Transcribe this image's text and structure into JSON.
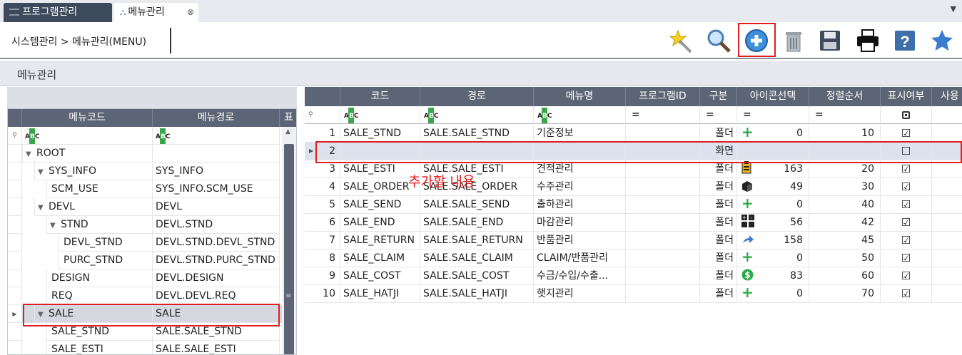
{
  "tabs": [
    {
      "label": "프로그램관리"
    },
    {
      "label": "메뉴관리"
    }
  ],
  "breadcrumb": "시스템관리 > 메뉴관리(MENU)",
  "toolbar": {
    "buttons": [
      "new-icon",
      "search-icon",
      "add-icon",
      "delete-icon",
      "save-icon",
      "print-icon",
      "help-icon",
      "favorite-icon"
    ],
    "highlighted": "add-icon"
  },
  "panel_title": "메뉴관리",
  "left_grid": {
    "columns": [
      "메뉴코드",
      "메뉴경로",
      "표"
    ],
    "rows": [
      {
        "level": 0,
        "expand": "▼",
        "code": "ROOT",
        "path": ""
      },
      {
        "level": 1,
        "expand": "▼",
        "code": "SYS_INFO",
        "path": "SYS_INFO"
      },
      {
        "level": 2,
        "expand": "",
        "code": "SCM_USE",
        "path": "SYS_INFO.SCM_USE"
      },
      {
        "level": 1,
        "expand": "▼",
        "code": "DEVL",
        "path": "DEVL"
      },
      {
        "level": 2,
        "expand": "▼",
        "code": "STND",
        "path": "DEVL.STND"
      },
      {
        "level": 3,
        "expand": "",
        "code": "DEVL_STND",
        "path": "DEVL.STND.DEVL_STND"
      },
      {
        "level": 3,
        "expand": "",
        "code": "PURC_STND",
        "path": "DEVL.STND.PURC_STND"
      },
      {
        "level": 2,
        "expand": "",
        "code": "DESIGN",
        "path": "DEVL.DESIGN"
      },
      {
        "level": 2,
        "expand": "",
        "code": "REQ",
        "path": "DEVL.DEVL.REQ"
      },
      {
        "level": 1,
        "expand": "▼",
        "code": "SALE",
        "path": "SALE"
      },
      {
        "level": 2,
        "expand": "",
        "code": "SALE_STND",
        "path": "SALE.SALE_STND"
      },
      {
        "level": 2,
        "expand": "",
        "code": "SALE_ESTI",
        "path": "SALE.SALE_ESTI"
      }
    ]
  },
  "right_grid": {
    "columns": [
      "코드",
      "경로",
      "메뉴명",
      "프로그램ID",
      "구분",
      "아이콘선택",
      "정렬순서",
      "표시여부",
      "사용"
    ],
    "rows": [
      {
        "no": "1",
        "code": "SALE_STND",
        "path": "SALE.SALE_STND",
        "name": "기준정보",
        "type": "폴더",
        "icon": "plus",
        "icon_no": "0",
        "order": "10",
        "show": "☑"
      },
      {
        "no": "2",
        "code": "",
        "path": "",
        "name": "",
        "type": "화면",
        "icon": "",
        "icon_no": "",
        "order": "",
        "show": "☐"
      },
      {
        "no": "3",
        "code": "SALE_ESTI",
        "path": "SALE.SALE_ESTI",
        "name": "견적관리",
        "type": "폴더",
        "icon": "clipboard",
        "icon_no": "163",
        "order": "20",
        "show": "☑"
      },
      {
        "no": "4",
        "code": "SALE_ORDER",
        "path": "SALE.SALE_ORDER",
        "name": "수주관리",
        "type": "폴더",
        "icon": "box",
        "icon_no": "49",
        "order": "30",
        "show": "☑"
      },
      {
        "no": "5",
        "code": "SALE_SEND",
        "path": "SALE.SALE_SEND",
        "name": "출하관리",
        "type": "폴더",
        "icon": "plus",
        "icon_no": "0",
        "order": "40",
        "show": "☑"
      },
      {
        "no": "6",
        "code": "SALE_END",
        "path": "SALE.SALE_END",
        "name": "마감관리",
        "type": "폴더",
        "icon": "calc",
        "icon_no": "56",
        "order": "42",
        "show": "☑"
      },
      {
        "no": "7",
        "code": "SALE_RETURN",
        "path": "SALE.SALE_RETURN",
        "name": "반품관리",
        "type": "폴더",
        "icon": "arrow",
        "icon_no": "158",
        "order": "45",
        "show": "☑"
      },
      {
        "no": "8",
        "code": "SALE_CLAIM",
        "path": "SALE.SALE_CLAIM",
        "name": "CLAIM/반품관리",
        "type": "폴더",
        "icon": "plus",
        "icon_no": "0",
        "order": "50",
        "show": "☑"
      },
      {
        "no": "9",
        "code": "SALE_COST",
        "path": "SALE.SALE_COST",
        "name": "수금/수입/수출...",
        "type": "폴더",
        "icon": "dollar",
        "icon_no": "83",
        "order": "60",
        "show": "☑"
      },
      {
        "no": "10",
        "code": "SALE_HATJI",
        "path": "SALE.SALE_HATJI",
        "name": "햇지관리",
        "type": "폴더",
        "icon": "plus",
        "icon_no": "0",
        "order": "70",
        "show": "☑"
      }
    ]
  },
  "annotation": "추가할 내용",
  "colors": {
    "accent": "#e02020",
    "header": "#5c6575",
    "selected_row": "#dde3ee"
  }
}
